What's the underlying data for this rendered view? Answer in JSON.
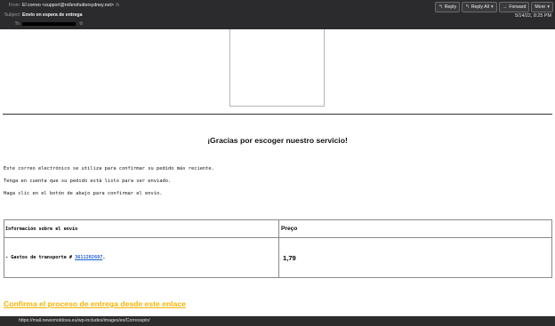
{
  "header": {
    "from_label": "From",
    "from_value": "El correo <support@rollershuttersydney.net>",
    "subject_label": "Subject",
    "subject_value": "Envío en espera de entrega",
    "to_label": "To",
    "date": "5/14/22, 8:25 PM"
  },
  "toolbar": {
    "reply": "Reply",
    "reply_all": "Reply All",
    "forward": "Forward",
    "more": "More"
  },
  "email": {
    "thanks": "¡Gracias por escoger nuestro servicio!",
    "para1": "Este correo electrónico se utiliza para confirmar su pedido más reciente.",
    "para2": "Tenga en cuenta que su pedido está listo para ser enviado.",
    "para3": "Haga clic en el botón de abajo para confirmar el envío.",
    "table": {
      "col1_header": "Información sobre el envío",
      "col2_header": "Preço",
      "row_label": "- Gastos de transporte # ",
      "row_link": "3611202697",
      "row_suffix": ".",
      "row_price": "1,79"
    },
    "cta": "Confirma el proceso de entrega desde este enlace"
  },
  "status_bar": {
    "url": "https://mail.newsmoldova.eu/wp-includes/images/es/Correospin/"
  },
  "colors": {
    "header_bg": "#2b2b2d",
    "link": "#1a5fd4",
    "cta": "#f5b400"
  }
}
